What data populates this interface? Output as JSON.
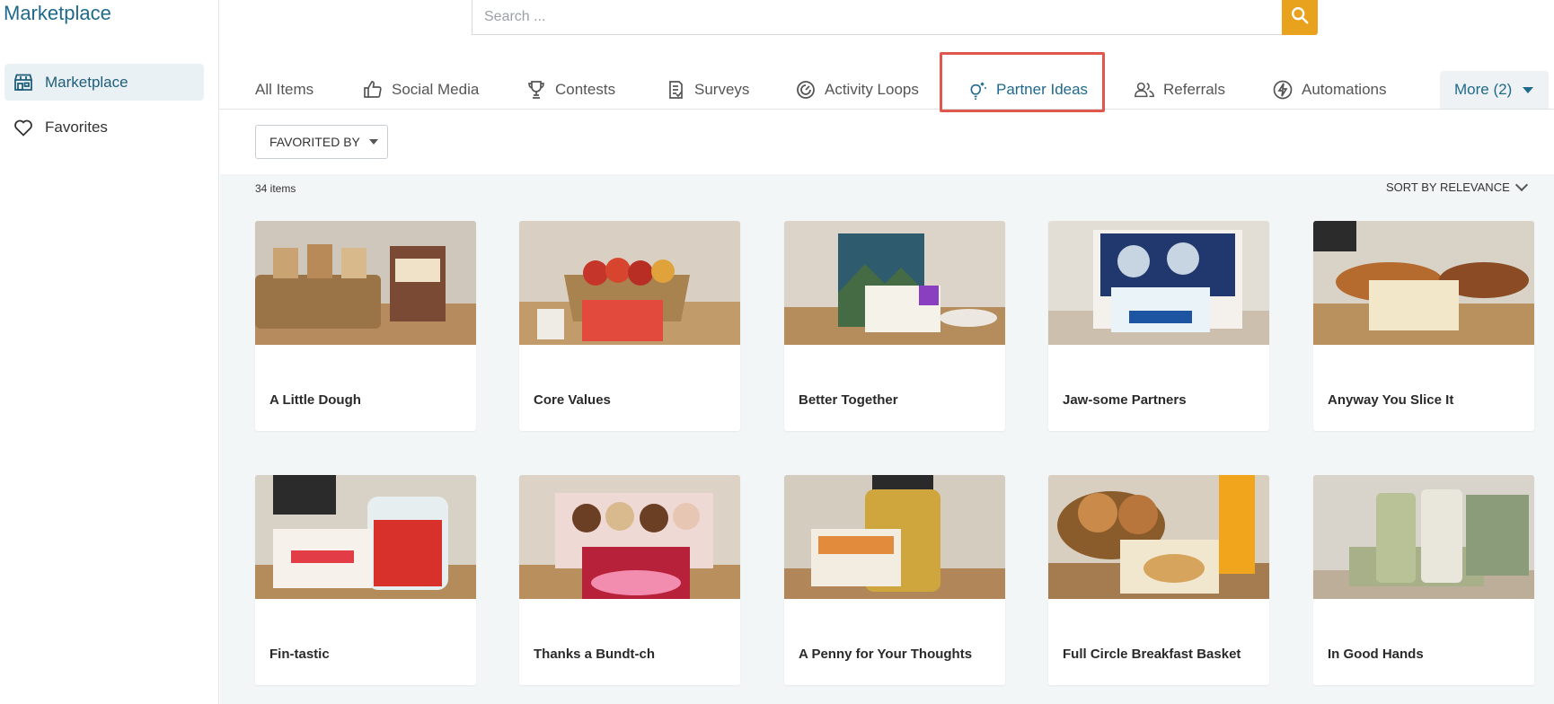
{
  "sidebar": {
    "brand": "Marketplace",
    "items": [
      {
        "label": "Marketplace",
        "icon": "store-icon",
        "active": true
      },
      {
        "label": "Favorites",
        "icon": "heart-icon",
        "active": false
      }
    ]
  },
  "search": {
    "placeholder": "Search ...",
    "value": "",
    "icon": "search-icon"
  },
  "tabs": [
    {
      "label": "All Items",
      "icon": ""
    },
    {
      "label": "Social Media",
      "icon": "thumbs-up-icon"
    },
    {
      "label": "Contests",
      "icon": "trophy-icon"
    },
    {
      "label": "Surveys",
      "icon": "clipboard-icon"
    },
    {
      "label": "Activity Loops",
      "icon": "loop-icon"
    },
    {
      "label": "Partner Ideas",
      "icon": "lightbulb-icon",
      "active": true
    },
    {
      "label": "Referrals",
      "icon": "people-icon"
    },
    {
      "label": "Automations",
      "icon": "bolt-icon"
    }
  ],
  "more_tab": {
    "label": "More (2)"
  },
  "filter": {
    "label": "FAVORITED BY"
  },
  "results": {
    "count": "34 items",
    "sort": "SORT BY RELEVANCE"
  },
  "cards": [
    {
      "title": "A Little Dough"
    },
    {
      "title": "Core Values"
    },
    {
      "title": "Better Together"
    },
    {
      "title": "Jaw-some Partners"
    },
    {
      "title": "Anyway You Slice It"
    },
    {
      "title": "Fin-tastic"
    },
    {
      "title": "Thanks a Bundt-ch"
    },
    {
      "title": "A Penny for Your Thoughts"
    },
    {
      "title": "Full Circle Breakfast Basket"
    },
    {
      "title": "In Good Hands"
    }
  ],
  "colors": {
    "accent": "#1f6a8a",
    "search_button": "#e8a21d",
    "highlight": "#e0574e",
    "content_bg": "#f3f6f7"
  }
}
